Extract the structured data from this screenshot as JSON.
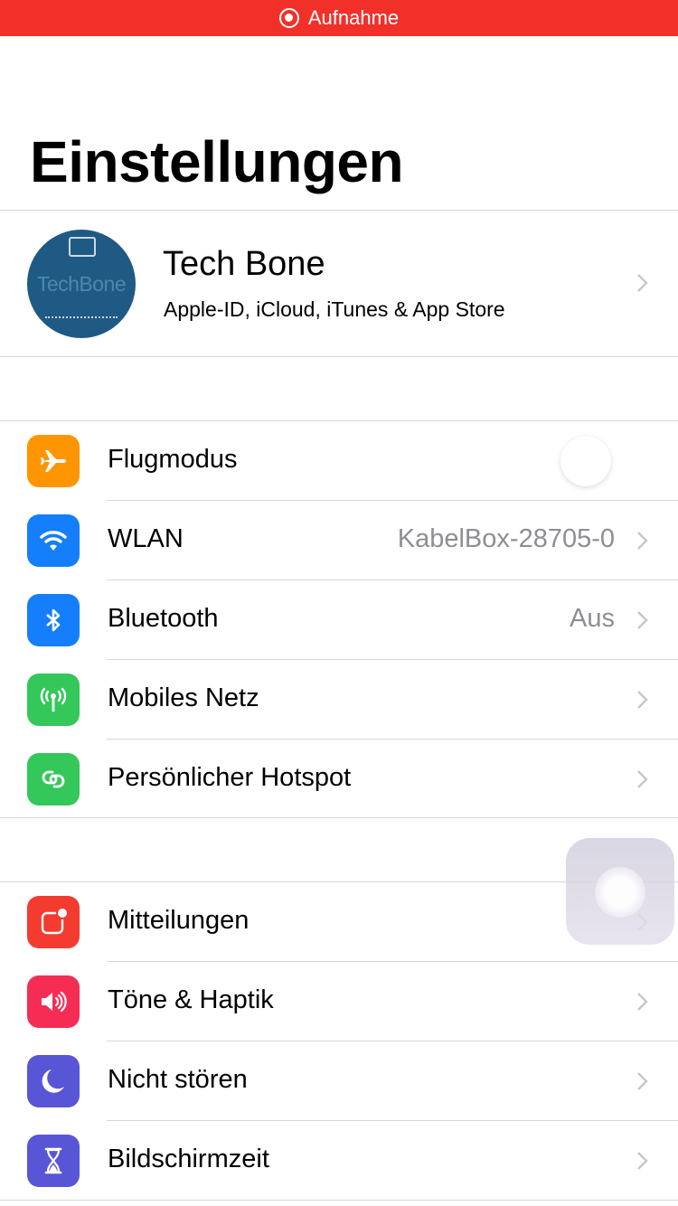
{
  "status_bar": {
    "recording_label": "Aufnahme",
    "color": "#f2302a"
  },
  "header": {
    "title": "Einstellungen"
  },
  "profile": {
    "name": "Tech Bone",
    "subtitle": "Apple-ID, iCloud, iTunes & App Store",
    "avatar_text": "TechBone"
  },
  "sections": [
    {
      "items": [
        {
          "label": "Flugmodus",
          "icon": "airplane-icon",
          "color": "#ff9500",
          "control": "toggle",
          "toggle_on": false
        },
        {
          "label": "WLAN",
          "icon": "wifi-icon",
          "color": "#147efb",
          "value": "KabelBox-28705-0"
        },
        {
          "label": "Bluetooth",
          "icon": "bluetooth-icon",
          "color": "#147efb",
          "value": "Aus"
        },
        {
          "label": "Mobiles Netz",
          "icon": "antenna-icon",
          "color": "#34c759"
        },
        {
          "label": "Persönlicher Hotspot",
          "icon": "hotspot-link-icon",
          "color": "#34c759"
        }
      ]
    },
    {
      "items": [
        {
          "label": "Mitteilungen",
          "icon": "notifications-icon",
          "color": "#f43b30"
        },
        {
          "label": "Töne & Haptik",
          "icon": "speaker-icon",
          "color": "#f52d55"
        },
        {
          "label": "Nicht stören",
          "icon": "moon-icon",
          "color": "#5856d6"
        },
        {
          "label": "Bildschirmzeit",
          "icon": "hourglass-icon",
          "color": "#5856d6"
        }
      ]
    }
  ]
}
